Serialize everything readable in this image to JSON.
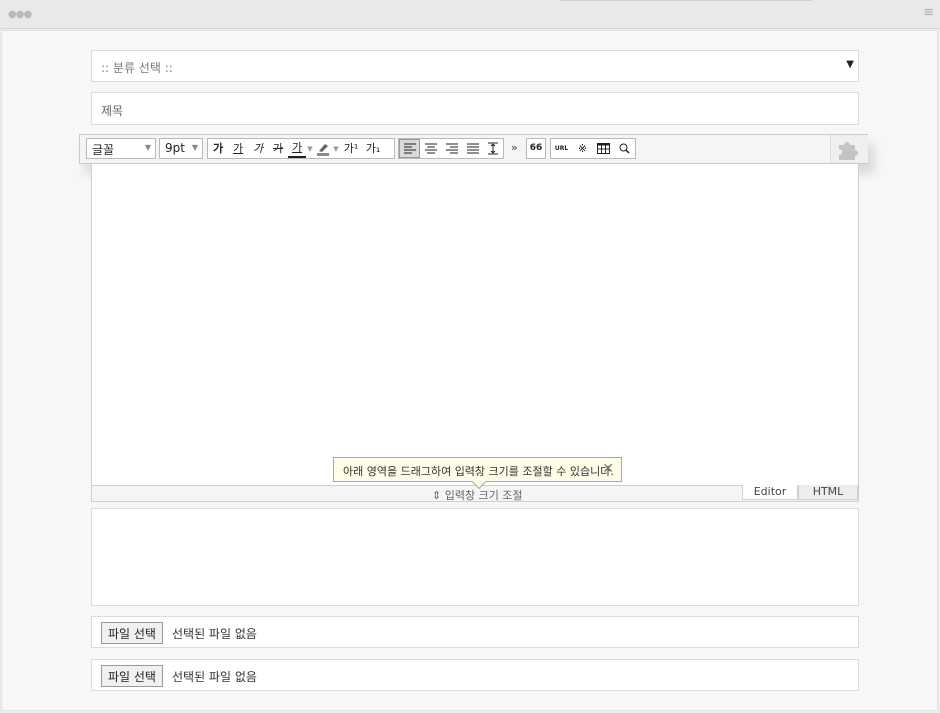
{
  "window": {
    "menu_icon": "hamburger-icon"
  },
  "form": {
    "category_placeholder": ":: 분류 선택 ::",
    "title_placeholder": "제목",
    "file_button_label": "파일 선택",
    "file_status": "선택된 파일 없음"
  },
  "toolbar": {
    "font_family": "글꼴",
    "font_size": "9pt",
    "format_buttons": [
      "가",
      "가",
      "가",
      "가",
      "가"
    ],
    "superscript": "가¹",
    "subscript": "가₁",
    "more": "»",
    "quote": "66",
    "url": "URL",
    "special_char": "※",
    "plugin_icon": "puzzle-icon"
  },
  "editor": {
    "resize_label": "⇕ 입력창 크기 조절",
    "tooltip_text": "아래 영역을 드래그하여 입력창 크기를 조절할 수 있습니다.",
    "mode_tabs": [
      "Editor",
      "HTML"
    ]
  }
}
